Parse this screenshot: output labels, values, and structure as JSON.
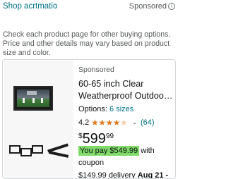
{
  "header": {
    "shop_link": "Shop acrtmatic",
    "shop_chevron": "›",
    "sponsored": "Sponsored",
    "info_icon": "i"
  },
  "notice": "Check each product page for other buying options. Price and other details may vary based on product size and color.",
  "product": {
    "sponsored": "Sponsored",
    "title": "60-65 inch Clear Weatherproof Outdoo…",
    "options_label": "Options: ",
    "options_link": "6 sizes",
    "rating": "4.2",
    "rating_value": 4.2,
    "stars": "★★★★",
    "star_empty": "★",
    "rating_chevron": "⌄",
    "review_count": "(64)",
    "price_symbol": "$",
    "price_whole": "599",
    "price_fraction": "99",
    "you_pay": "You pay $549.99",
    "you_pay_suffix": "with",
    "coupon": "coupon",
    "delivery_prefix": "$149.99 delivery ",
    "delivery_date": "Aug 21 -"
  },
  "colors": {
    "link": "#007185",
    "star": "#de7921",
    "badge": "#7fda69",
    "muted": "#565959"
  },
  "icons": [
    "info-icon",
    "chevron-right-icon",
    "chevron-down-icon",
    "star-icon"
  ]
}
